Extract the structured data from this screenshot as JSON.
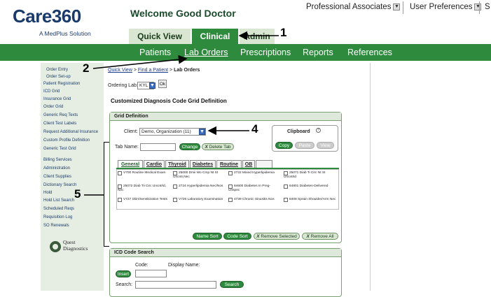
{
  "logo": {
    "brand": "Care360",
    "tagline": "A MedPlus Solution"
  },
  "welcome": "Welcome Good Doctor",
  "topnav": {
    "org": "Professional Associates",
    "prefs": "User Preferences",
    "more": "S"
  },
  "tabs": {
    "quick": "Quick View",
    "clinical": "Clinical",
    "admin": "Admin"
  },
  "subnav": [
    "Patients",
    "Lab Orders",
    "Prescriptions",
    "Reports",
    "References"
  ],
  "sidebar": [
    "Order Entry",
    "Order Set-up",
    "Patient Registration",
    "ICD Grid",
    "Insurance Grid",
    "Order Grid",
    "Generic Req Texts",
    "Client Test Labels",
    "Request Additional Insurance",
    "Custom Profile Definition",
    "Generic Test Grid",
    "Billing Services",
    "Administration",
    "Client Supplies",
    "Dictionary Search",
    "Hold",
    "Hold List Search",
    "Scheduled Reqs",
    "Requisition Log",
    "SO Renewals"
  ],
  "quest": {
    "line1": "Quest",
    "line2": "Diagnostics"
  },
  "breadcrumb": {
    "a": "Quick View",
    "sep1": ">",
    "b": "Find a Patient",
    "sep2": ">",
    "c": "Lab Orders"
  },
  "ordering_lab": {
    "label": "Ordering Lab:",
    "value": "KYL",
    "ok": "Ok"
  },
  "page_title": "Customized Diagnosis Code Grid Definition",
  "grid_def": {
    "title": "Grid Definition",
    "client_label": "Client:",
    "client_value": "Demo, Organization (11)",
    "tabname_label": "Tab Name:",
    "change": "Change",
    "delete_tab": "Delete Tab"
  },
  "clipboard": {
    "title": "Clipboard",
    "copy": "Copy",
    "paste": "Paste",
    "view": "View"
  },
  "grid_tabs": [
    "General",
    "Cardio",
    "Thyroid",
    "Diabetes",
    "Routine",
    "OB"
  ],
  "grid_cells": [
    [
      "V700 Routine Medical Exam",
      "25000 Dmii Wo Cmp Nt St Uncntr,Nec",
      "2722 Mixed Hyperlipidemia",
      "25071 Diab Ti Circ Nt St Uncntrld"
    ],
    [
      "25072 Diab Tii Circ Uncntrld, Nec",
      "2724 Hyperlipidemia Nec/Nos",
      "84600 Diabetes In Preg-Unspec",
      "64801 Diabetes-Delivered"
    ],
    [
      "V727 Skin/Sensitization Tests",
      "V726 Laboratory Examination",
      "4739 Chronic Sinusitis Nos",
      "8409 Sprain Shoulder/Arm Nec"
    ]
  ],
  "grid_buttons": {
    "name_sort": "Name Sort",
    "code_sort": "Code Sort",
    "remove_selected": "Remove Selected",
    "remove_all": "Remove All"
  },
  "icd_search": {
    "title": "ICD Code Search",
    "code": "Code:",
    "display": "Display Name:",
    "insert": "Insert",
    "search_label": "Search:",
    "search_btn": "Search"
  },
  "callouts": [
    "1",
    "2",
    "4",
    "5"
  ]
}
